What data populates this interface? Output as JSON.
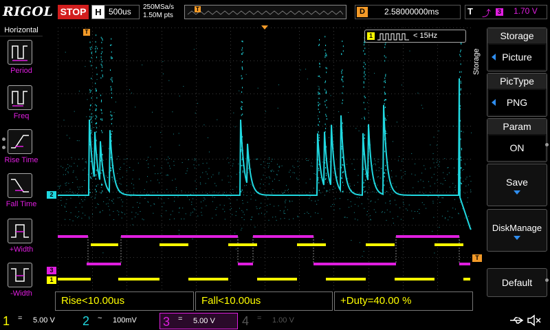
{
  "topbar": {
    "brand": "RIGOL",
    "run_state": "STOP",
    "h_label": "H",
    "timebase": "500us",
    "sample_rate": "250MSa/s",
    "memory_depth": "1.50M pts",
    "trigger_marker": "T",
    "delay_label": "D",
    "delay_value": "2.58000000ms",
    "trig_label": "T",
    "trig_edge_icon": "rising-edge-icon",
    "trig_source": "3",
    "trig_level": "1.70 V"
  },
  "left_menu": {
    "title": "Horizontal",
    "items": [
      {
        "label": "Period",
        "icon": "period-icon"
      },
      {
        "label": "Freq",
        "icon": "freq-icon"
      },
      {
        "label": "Rise Time",
        "icon": "rise-time-icon"
      },
      {
        "label": "Fall Time",
        "icon": "fall-time-icon"
      },
      {
        "label": "+Width",
        "icon": "positive-width-icon"
      },
      {
        "label": "-Width",
        "icon": "negative-width-icon"
      }
    ]
  },
  "counter": {
    "channel": "1",
    "value": "< 15Hz"
  },
  "markers": {
    "ch2": "2",
    "ch3": "3",
    "ch1": "1",
    "trig": "T"
  },
  "right_menu": {
    "side_label": "Storage",
    "title": "Storage",
    "storage_value": "Picture",
    "pictype_title": "PicType",
    "pictype_value": "PNG",
    "param_title": "Param",
    "param_value": "ON",
    "save": "Save",
    "disk_manage": "DiskManage",
    "default": "Default"
  },
  "measurements": [
    "Rise<10.00us",
    "Fall<10.00us",
    "+Duty=40.00 %"
  ],
  "channels": [
    {
      "num": "1",
      "coupling": "=",
      "scale": "5.00 V",
      "color": "#ffff00"
    },
    {
      "num": "2",
      "coupling": "~",
      "scale": "100mV",
      "color": "#20d8e0"
    },
    {
      "num": "3",
      "coupling": "=",
      "scale": "5.00 V",
      "color": "#e01ee0"
    },
    {
      "num": "4",
      "coupling": "=",
      "scale": "1.00 V",
      "color": "#555555"
    }
  ],
  "status_icons": [
    "usb-icon",
    "speaker-muted-icon"
  ],
  "colors": {
    "ch1": "#ffff00",
    "ch2": "#20d8e0",
    "ch3": "#e01ee0",
    "trigger": "#f39a28",
    "accent": "#2f8ef0",
    "stop": "#d21e1e"
  }
}
